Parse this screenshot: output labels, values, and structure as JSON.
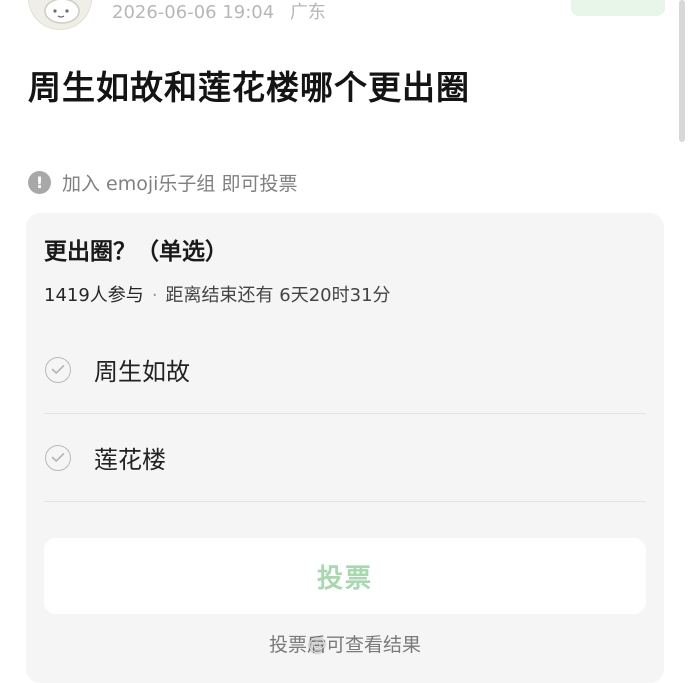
{
  "header": {
    "timestamp": "2026-06-06 19:04",
    "location": "广东"
  },
  "post": {
    "title": "周生如故和莲花楼哪个更出圈"
  },
  "notice": {
    "icon": "exclamation-icon",
    "text": "加入 emoji乐子组 即可投票"
  },
  "poll": {
    "question": "更出圈？（单选）",
    "participants": "1419人参与",
    "separator": "·",
    "remaining": "距离结束还有 6天20时31分",
    "options": [
      {
        "label": "周生如故"
      },
      {
        "label": "莲花楼"
      }
    ],
    "vote_label": "投票",
    "hint": "投票后可查看结果"
  },
  "colors": {
    "accent_green_soft": "#a9d8b0",
    "follow_bg": "#e8f5e9",
    "card_bg": "#f5f5f5"
  }
}
